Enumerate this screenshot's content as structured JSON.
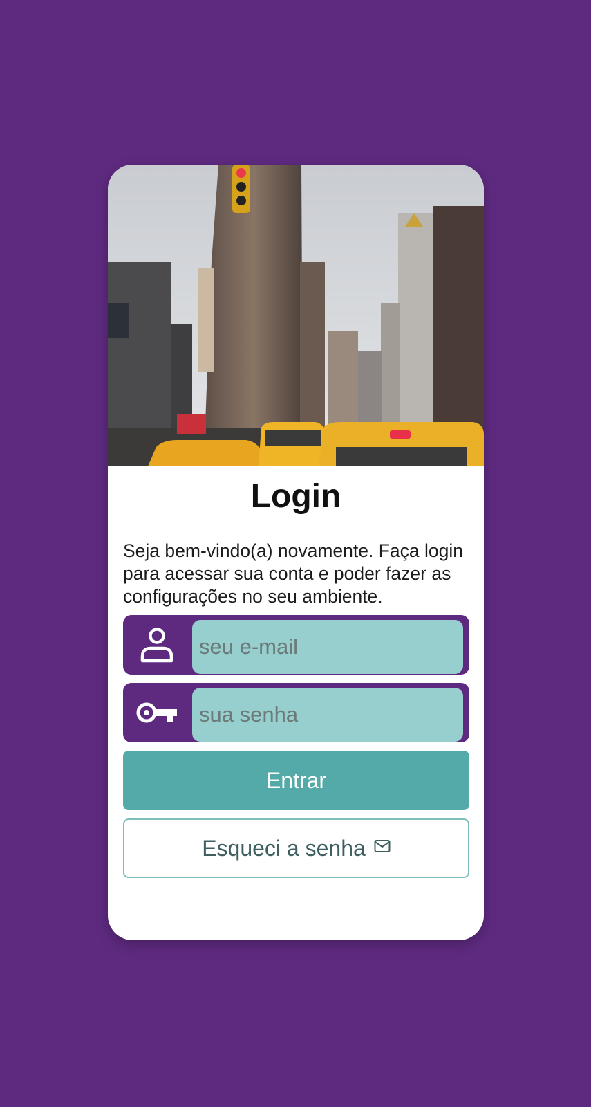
{
  "login": {
    "title": "Login",
    "description": "Seja bem-vindo(a) novamente. Faça login para acessar sua conta e poder fazer as configurações no seu ambiente.",
    "email_placeholder": "seu e-mail",
    "password_placeholder": "sua senha",
    "submit_label": "Entrar",
    "forgot_label": "Esqueci a senha"
  },
  "icons": {
    "email_field": "user-icon",
    "password_field": "key-icon",
    "forgot_button": "mail-icon"
  },
  "colors": {
    "background": "#5e2a80",
    "input_fill": "#96cfcd",
    "primary_button": "#53aaa8",
    "secondary_text": "#3d5f5f"
  }
}
